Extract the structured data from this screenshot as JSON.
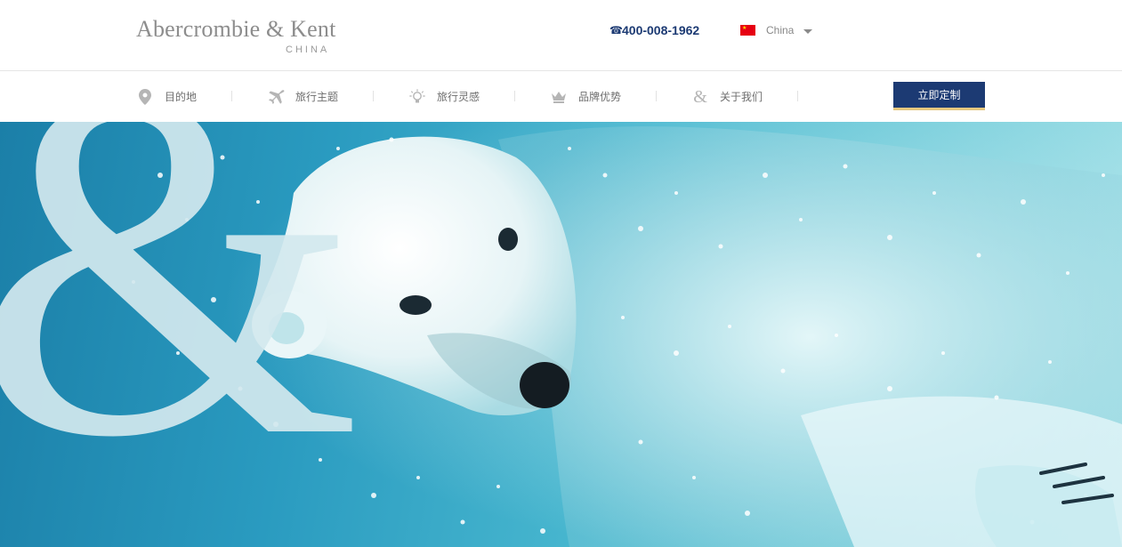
{
  "header": {
    "logo_main": "Abercrombie & Kent",
    "logo_sub": "CHINA",
    "phone": "400-008-1962",
    "phone_icon": "phone-icon",
    "country": "China",
    "country_flag": "china-flag-icon"
  },
  "nav": {
    "items": [
      {
        "label": "目的地",
        "icon": "location-pin-icon"
      },
      {
        "label": "旅行主题",
        "icon": "airplane-icon"
      },
      {
        "label": "旅行灵感",
        "icon": "lightbulb-icon"
      },
      {
        "label": "品牌优势",
        "icon": "crown-icon"
      },
      {
        "label": "关于我们",
        "icon": "ampersand-icon"
      }
    ],
    "cta_label": "立即定制"
  },
  "hero": {
    "image": "polar-bear-underwater-photo",
    "overlay_glyph": "&"
  },
  "colors": {
    "brand_navy": "#1c3a73",
    "cta_underline": "#e5c77e",
    "nav_text": "#6e6e6e",
    "logo_gray": "#8d8d8d"
  }
}
